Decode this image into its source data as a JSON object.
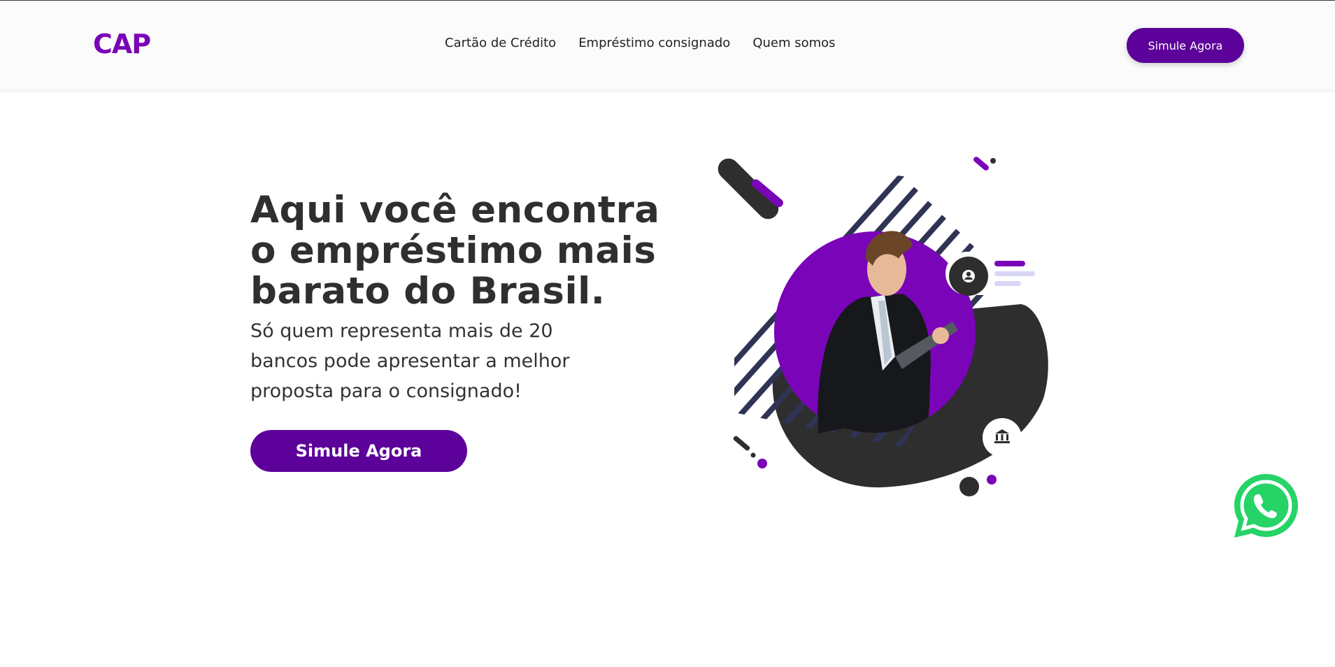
{
  "colors": {
    "brand": "#7a05b8",
    "brand_dark": "#5c0199",
    "dark": "#2e2e2e",
    "stripes": "#2f3455",
    "whatsapp": "#25d366"
  },
  "header": {
    "logo": "CAP",
    "nav": [
      {
        "label": "Cartão de Crédito"
      },
      {
        "label": "Empréstimo consignado"
      },
      {
        "label": "Quem somos"
      }
    ],
    "cta_label": "Simule Agora"
  },
  "hero": {
    "title": "Aqui você encontra o empréstimo mais barato do Brasil.",
    "subtitle": "Só quem representa mais de 20 bancos pode apresentar a melhor proposta para o consignado!",
    "cta_label": "Simule Agora"
  },
  "icons": {
    "illustration": "businessman-with-tablet-illustration",
    "profile_badge": "user-icon",
    "bank_badge": "bank-icon",
    "floating_button": "whatsapp-icon"
  }
}
